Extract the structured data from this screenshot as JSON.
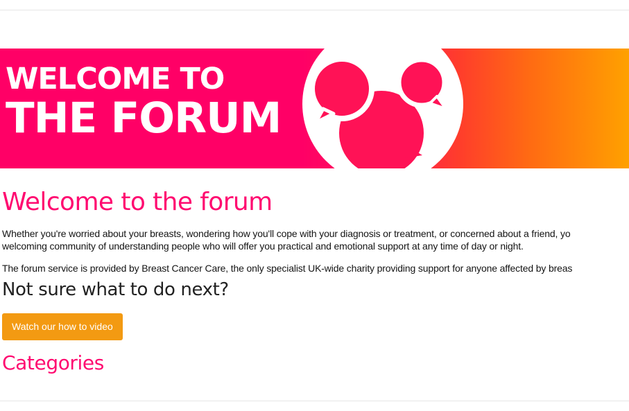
{
  "banner": {
    "line_1": "WELCOME TO",
    "line_2": "THE FORUM",
    "icon": "speech-bubbles-icon",
    "colors": {
      "pink": "#ff0066",
      "orange": "#ffa100",
      "white": "#ffffff",
      "bubble": "#ff1256"
    }
  },
  "main": {
    "title": "Welcome to the forum",
    "intro_line_1": "Whether you're worried about your breasts, wondering how you'll cope with your diagnosis or treatment, or concerned about a friend, yo",
    "intro_line_2": "welcoming community of understanding people who will offer you practical and emotional support at any time of day or night.",
    "service_text": "The forum service is provided by Breast Cancer Care, the only specialist UK-wide charity providing support for anyone affected by breas",
    "next_heading": "Not sure what to do next?",
    "video_button_label": "Watch our how to video",
    "categories_heading": "Categories"
  },
  "theme": {
    "accent_pink": "#ff0a70",
    "button_orange": "#f39a12",
    "rule_gray": "#e6e6e6"
  }
}
